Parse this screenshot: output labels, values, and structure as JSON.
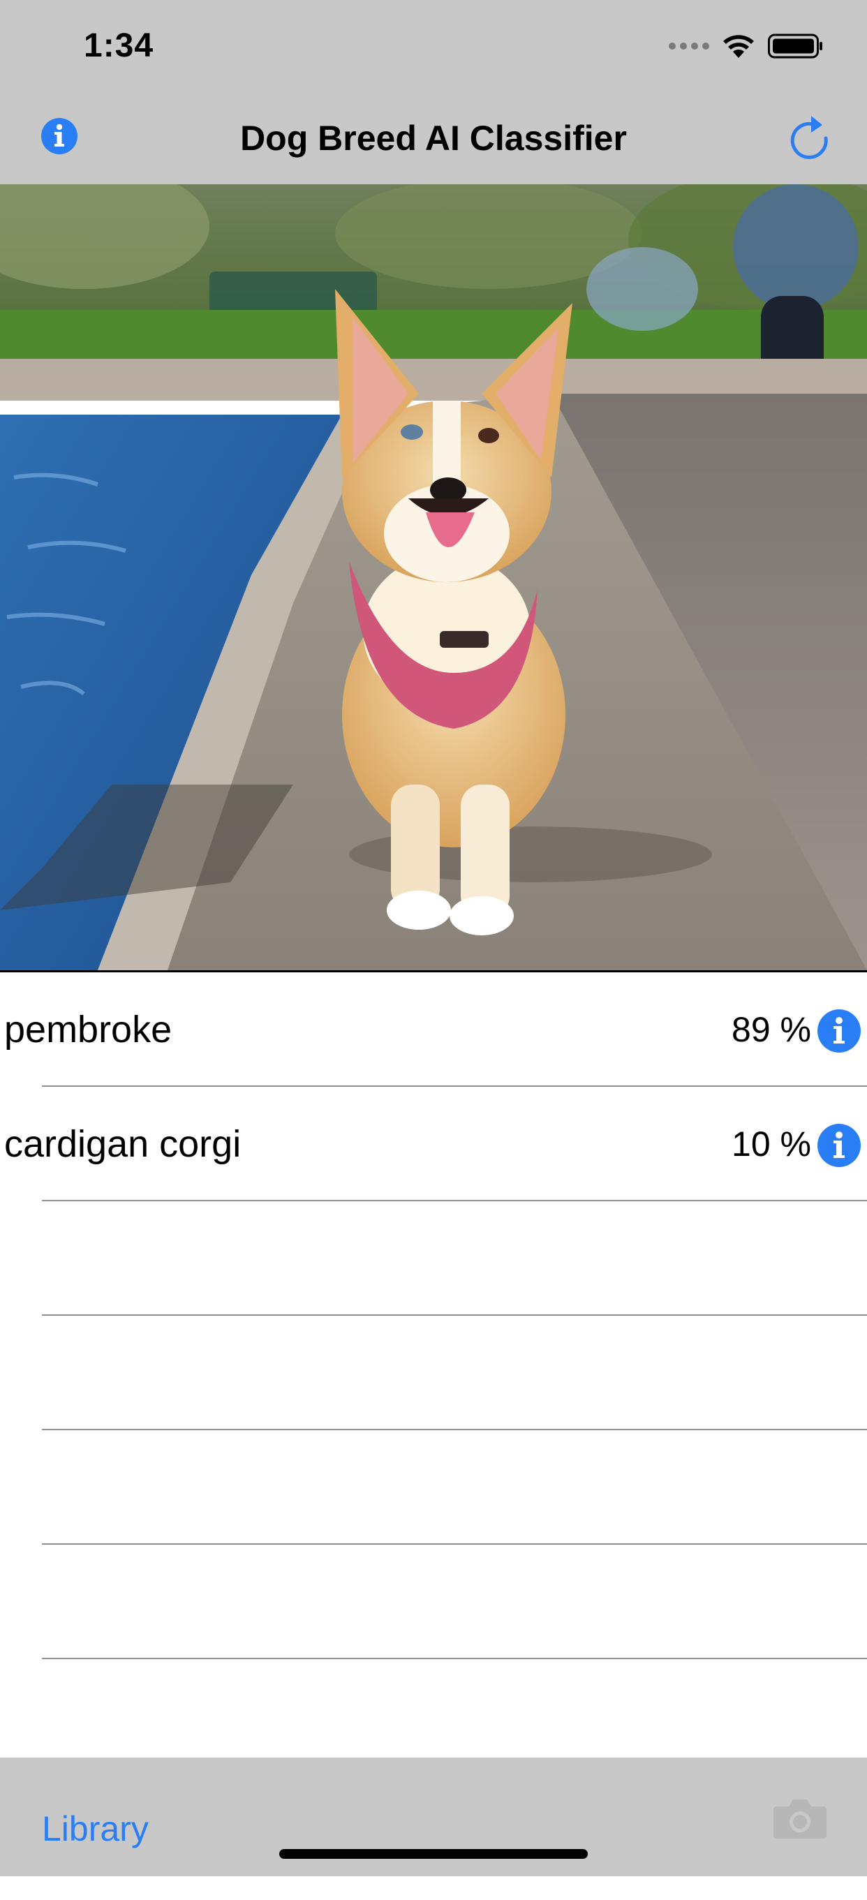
{
  "status_bar": {
    "time": "1:34"
  },
  "nav": {
    "title": "Dog Breed AI Classifier",
    "left_icon": "info-icon",
    "right_icon": "refresh-icon"
  },
  "photo": {
    "subject": "corgi-photo"
  },
  "results": [
    {
      "breed": "pembroke",
      "percent": "89 %"
    },
    {
      "breed": "cardigan corgi",
      "percent": "10 %"
    }
  ],
  "toolbar": {
    "library_label": "Library",
    "camera_icon": "camera-icon"
  },
  "colors": {
    "accent": "#2a7ef5",
    "bar_gray": "#c8c8c8"
  }
}
